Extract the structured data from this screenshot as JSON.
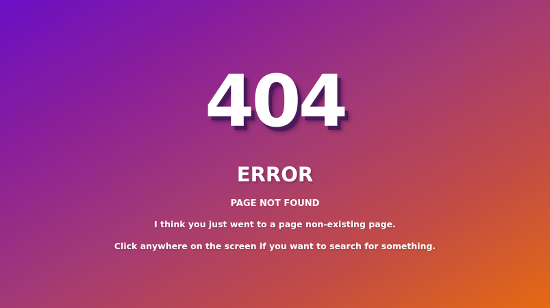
{
  "error_page": {
    "code": "404",
    "title": "ERROR",
    "subtitle": "PAGE NOT FOUND",
    "message": "I think you just went to a page non-existing page.",
    "hint": "Click anywhere on the screen if you want to search for something."
  },
  "colors": {
    "gradient_start": "#6a0fc4",
    "gradient_mid": "#a43a74",
    "gradient_end": "#e56a12",
    "text": "#ffffff",
    "code_shadow": "#4a1a5a"
  }
}
